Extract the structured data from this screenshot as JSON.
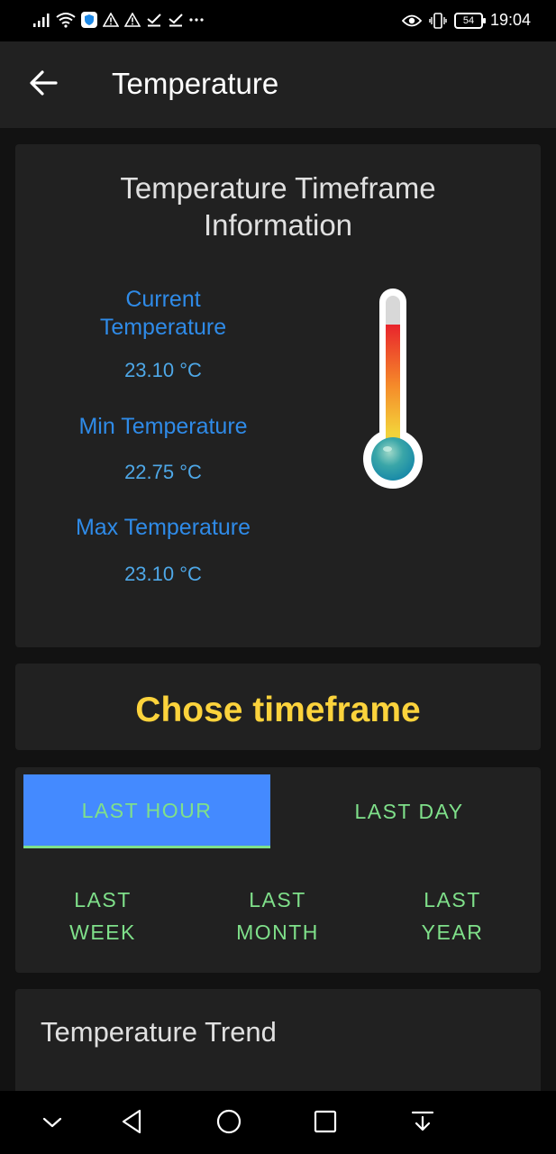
{
  "status_bar": {
    "time": "19:04",
    "battery": "54",
    "left_icons": [
      "signal-icon",
      "wifi-icon",
      "shield-app-icon",
      "warning-icon",
      "warning-icon",
      "check-icon",
      "check-icon",
      "more-icon"
    ],
    "right_icons": [
      "eye-icon",
      "vibrate-icon",
      "battery-icon"
    ]
  },
  "app_bar": {
    "title": "Temperature"
  },
  "info_card": {
    "title": "Temperature Timeframe Information",
    "current_label": "Current Temperature",
    "current_value": "23.10 °C",
    "min_label": "Min Temperature",
    "min_value": "22.75 °C",
    "max_label": "Max Temperature",
    "max_value": "23.10 °C"
  },
  "timeframe_card": {
    "title": "Chose timeframe"
  },
  "timeframe_buttons": {
    "last_hour": "LAST HOUR",
    "last_day": "LAST DAY",
    "last_week": "LAST\nWEEK",
    "last_month": "LAST\nMONTH",
    "last_year": "LAST\nYEAR",
    "selected": "last_hour"
  },
  "trend_card": {
    "title": "Temperature Trend"
  },
  "colors": {
    "label_blue": "#2f8be8",
    "value_blue": "#4ea8e8",
    "accent_yellow": "#fcd33c",
    "button_green": "#7fe08a",
    "active_blue": "#448aff"
  }
}
